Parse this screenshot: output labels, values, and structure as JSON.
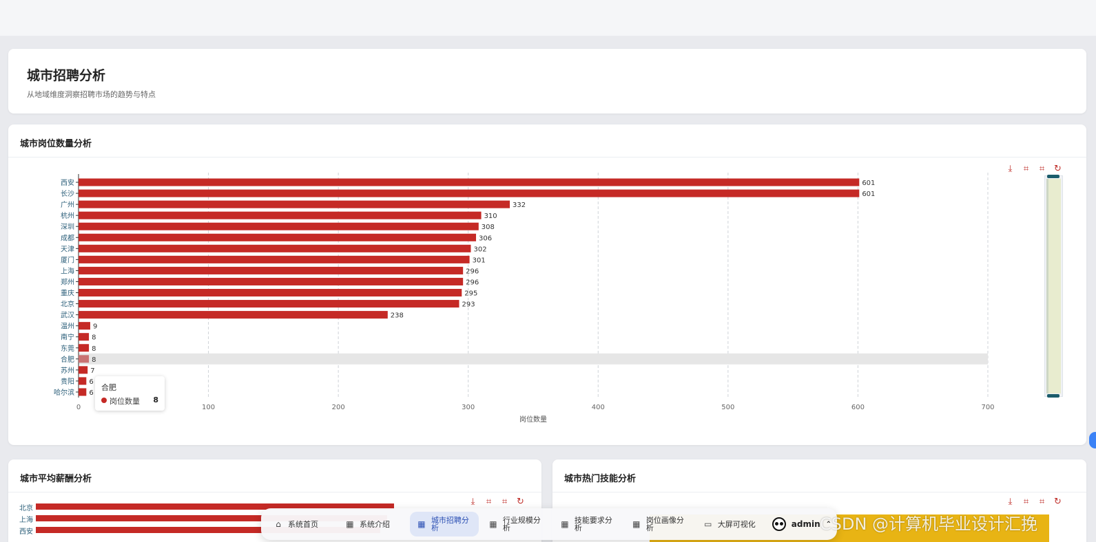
{
  "header": {
    "title": "城市招聘分析",
    "subtitle": "从地域维度洞察招聘市场的趋势与特点"
  },
  "panels": {
    "jobs_title": "城市岗位数量分析",
    "salary_title": "城市平均薪酬分析",
    "skills_title": "城市热门技能分析"
  },
  "toolbox": [
    "download-icon",
    "zoom-icon",
    "zoom-reset-icon",
    "restore-icon"
  ],
  "chart_data": {
    "type": "bar",
    "orientation": "horizontal",
    "categories": [
      "西安",
      "长沙",
      "广州",
      "杭州",
      "深圳",
      "成都",
      "天津",
      "厦门",
      "上海",
      "郑州",
      "重庆",
      "北京",
      "武汉",
      "温州",
      "南宁",
      "东莞",
      "合肥",
      "苏州",
      "贵阳",
      "哈尔滨"
    ],
    "series": [
      {
        "name": "岗位数量",
        "values": [
          601,
          601,
          332,
          310,
          308,
          306,
          302,
          301,
          296,
          296,
          295,
          293,
          238,
          9,
          8,
          8,
          8,
          7,
          6,
          6
        ]
      }
    ],
    "xlabel": "岗位数量",
    "xlim": [
      0,
      700
    ],
    "xticks": [
      0,
      100,
      200,
      300,
      400,
      500,
      600,
      700
    ],
    "grid": true,
    "color": "#c52a26",
    "tooltip": {
      "category": "合肥",
      "series": "岗位数量",
      "value": "8"
    }
  },
  "salary_preview": {
    "cities": [
      "北京",
      "上海",
      "西安"
    ]
  },
  "nav": {
    "items": [
      {
        "label": "系统首页",
        "icon": "home-icon"
      },
      {
        "label": "系统介绍",
        "icon": "grid-icon"
      },
      {
        "label": "城市招聘分析",
        "icon": "grid-icon",
        "active": true
      },
      {
        "label": "行业规模分析",
        "icon": "grid-icon"
      },
      {
        "label": "技能要求分析",
        "icon": "grid-icon"
      },
      {
        "label": "岗位画像分析",
        "icon": "grid-icon"
      },
      {
        "label": "大屏可视化",
        "icon": "screen-icon"
      }
    ],
    "user": "admin"
  },
  "watermark": "CSDN @计算机毕业设计汇挽"
}
